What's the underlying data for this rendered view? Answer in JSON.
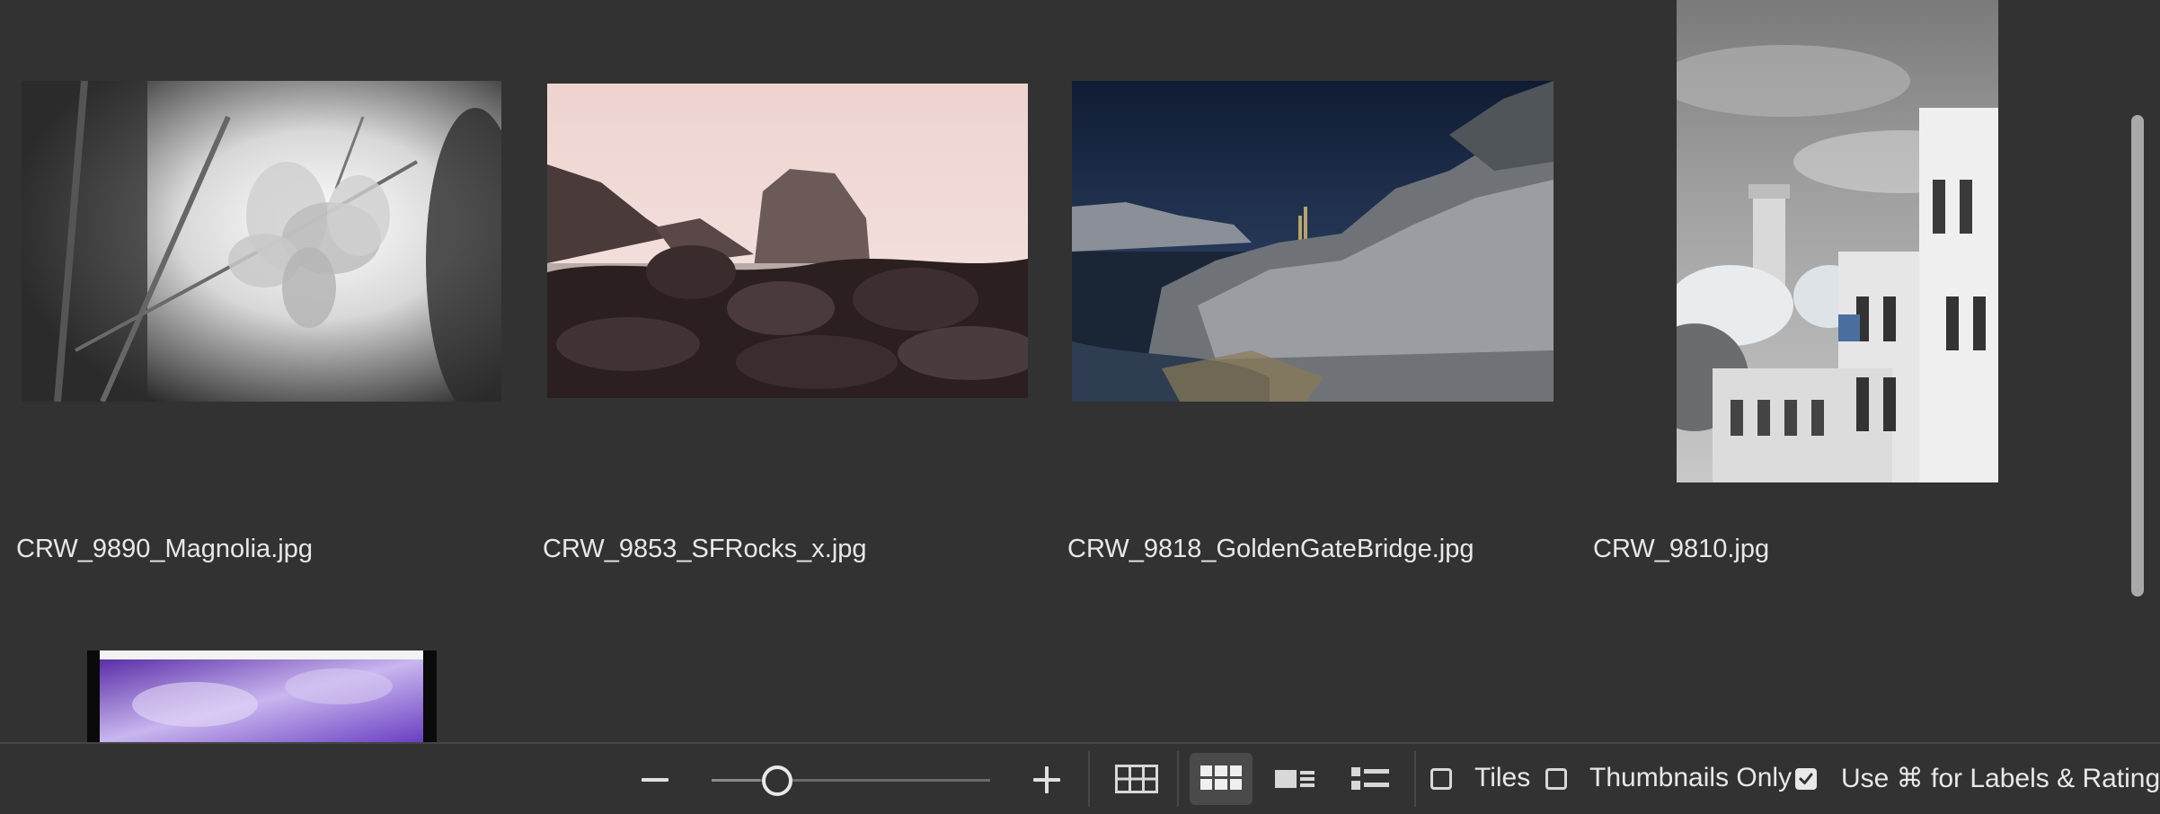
{
  "grid": {
    "items": [
      {
        "filename": "CRW_9890_Magnolia.jpg",
        "image": "magnolia-photo"
      },
      {
        "filename": "CRW_9853_SFRocks_x.jpg",
        "image": "sf-rocks-photo"
      },
      {
        "filename": "CRW_9818_GoldenGateBridge.jpg",
        "image": "golden-gate-photo"
      },
      {
        "filename": "CRW_9810.jpg",
        "image": "coit-tower-photo"
      },
      {
        "filename": "",
        "image": "purple-abstract-photo"
      }
    ]
  },
  "footer": {
    "zoom_out_icon": "minus-icon",
    "zoom_in_icon": "plus-icon",
    "zoom_level": 0.12,
    "views": [
      {
        "icon": "grid-view-icon",
        "selected": false
      },
      {
        "icon": "large-grid-view-icon",
        "selected": true
      },
      {
        "icon": "detail-view-icon",
        "selected": false
      },
      {
        "icon": "list-view-icon",
        "selected": false
      }
    ],
    "tiles_label": "Tiles",
    "tiles_checked": false,
    "thumbnails_only_label": "Thumbnails Only",
    "thumbnails_only_checked": false,
    "cmd_labels_label": "Use ⌘ for Labels & Ratings",
    "cmd_labels_checked": true
  },
  "colors": {
    "background": "#323232",
    "selected_view": "#4a4a4a",
    "text": "#e8e8e8"
  }
}
